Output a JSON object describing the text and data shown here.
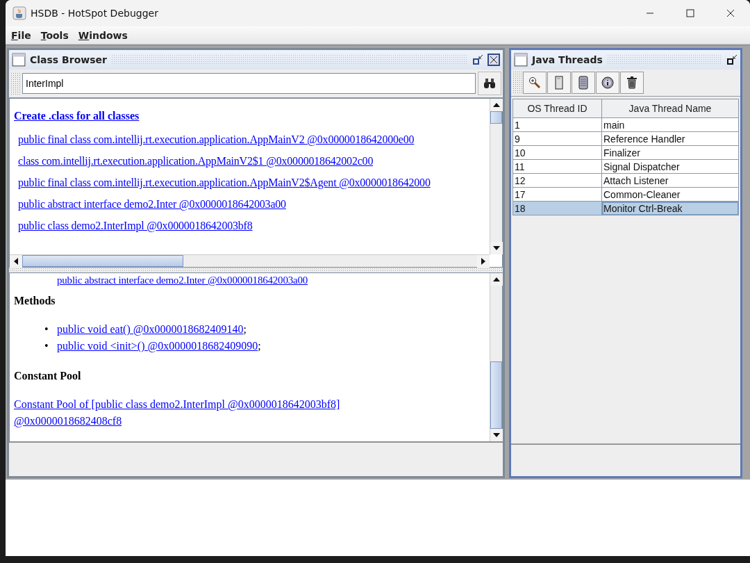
{
  "window": {
    "title": "HSDB - HotSpot Debugger"
  },
  "menu": [
    {
      "label": "File"
    },
    {
      "label": "Tools"
    },
    {
      "label": "Windows"
    }
  ],
  "class_browser": {
    "title": "Class Browser",
    "search": {
      "value": "InterImpl"
    },
    "create_link": "Create .class for all classes",
    "classes": [
      "public final class com.intellij.rt.execution.application.AppMainV2 @0x0000018642000e00",
      "class com.intellij.rt.execution.application.AppMainV2$1 @0x0000018642002c00",
      "public final class com.intellij.rt.execution.application.AppMainV2$Agent @0x0000018642000",
      "public abstract interface demo2.Inter @0x0000018642003a00",
      "public class demo2.InterImpl @0x0000018642003bf8"
    ],
    "detail": {
      "interface_link": "public abstract interface demo2.Inter @0x0000018642003a00",
      "methods_heading": "Methods",
      "methods": [
        {
          "bullet": "•",
          "link": "public void eat() @0x0000018682409140",
          "suffix": ";"
        },
        {
          "bullet": "•",
          "link": "public void <init>() @0x0000018682409090",
          "suffix": ";"
        }
      ],
      "pool_heading": "Constant Pool",
      "pool_link": "Constant Pool of [public class demo2.InterImpl @0x0000018642003bf8] @0x0000018682408cf8"
    }
  },
  "java_threads": {
    "title": "Java Threads",
    "toolbar": [
      {
        "kind": "inspect"
      },
      {
        "kind": "stack"
      },
      {
        "kind": "memory"
      },
      {
        "kind": "info"
      },
      {
        "kind": "delete"
      }
    ],
    "table": {
      "columns": [
        "OS Thread ID",
        "Java Thread Name"
      ],
      "rows": [
        {
          "id": "1",
          "name": "main",
          "selected": false
        },
        {
          "id": "9",
          "name": "Reference Handler",
          "selected": false
        },
        {
          "id": "10",
          "name": "Finalizer",
          "selected": false
        },
        {
          "id": "11",
          "name": "Signal Dispatcher",
          "selected": false
        },
        {
          "id": "12",
          "name": "Attach Listener",
          "selected": false
        },
        {
          "id": "17",
          "name": "Common-Cleaner",
          "selected": false
        },
        {
          "id": "18",
          "name": "Monitor Ctrl-Break",
          "selected": true
        }
      ]
    }
  }
}
